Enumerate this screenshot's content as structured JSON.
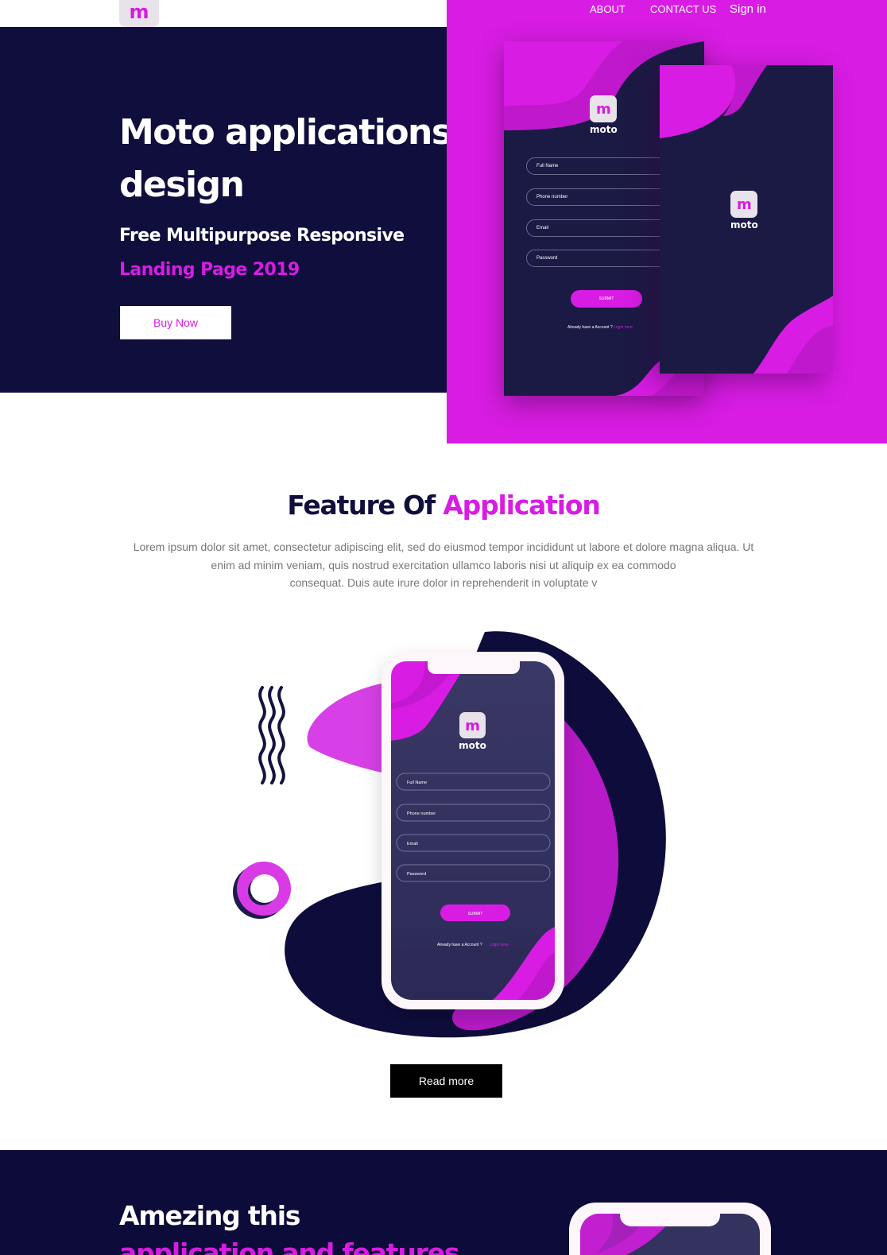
{
  "brand": {
    "logo_letter": "m",
    "app_word": "moto"
  },
  "colors": {
    "navy": "#100e3d",
    "magenta": "#d81ce3",
    "white": "#ffffff"
  },
  "nav": {
    "about": "ABOUT",
    "contact": "CONTACT US",
    "signin": "Sign in"
  },
  "hero": {
    "title_line1": "Moto applications",
    "title_line2": "design",
    "subtitle_line1": "Free Multipurpose Responsive",
    "subtitle_line2": "Landing Page 2019",
    "cta": "Buy Now"
  },
  "mockup_form": {
    "fields": [
      "Full Name",
      "Phone number",
      "Email",
      "Password"
    ],
    "submit": "SUBMIT",
    "footer_text": "Already have a Account ?",
    "footer_link": "Login here"
  },
  "features": {
    "title_part1": "Feature Of",
    "title_part2": "Application",
    "text_line1": "Lorem ipsum dolor sit amet, consectetur adipiscing elit, sed do eiusmod tempor incididunt ut labore et dolore magna aliqua. Ut",
    "text_line2": "enim ad minim veniam, quis nostrud exercitation ullamco laboris nisi ut aliquip ex ea commodo",
    "text_line3": "consequat. Duis aute irure dolor in reprehenderit in voluptate v",
    "read_more": "Read more"
  },
  "amazing": {
    "title_line1": "Amezing this",
    "title_line2": "application and features"
  }
}
